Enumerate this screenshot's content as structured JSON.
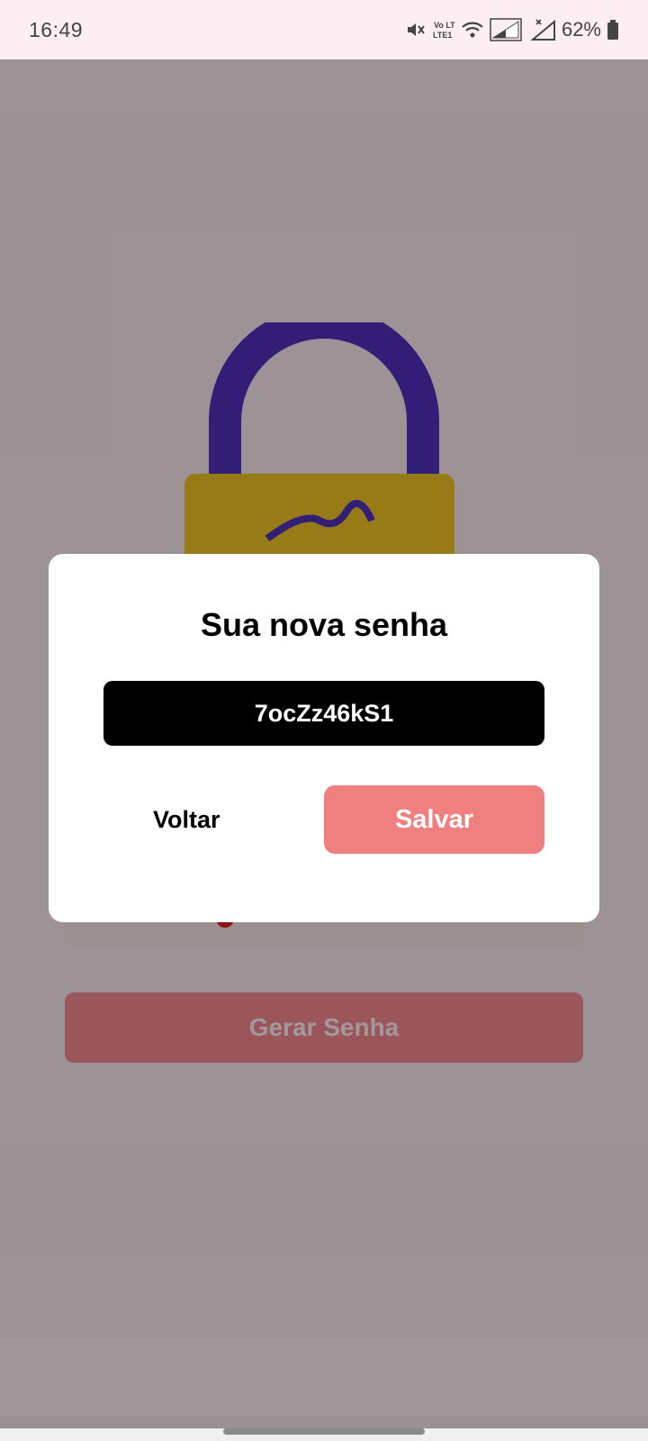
{
  "status_bar": {
    "time": "16:49",
    "battery_percent": "62%",
    "icons": [
      "mute-icon",
      "volte-icon",
      "wifi-icon",
      "signal-icon",
      "signal-no-service-icon",
      "battery-icon"
    ],
    "volte_label": "Vo LTE1"
  },
  "background": {
    "generate_label": "Gerar Senha",
    "accent_color": "#f08080",
    "lock_shackle_color": "#2a15b8",
    "lock_body_color": "#e8c800"
  },
  "dialog": {
    "title": "Sua nova senha",
    "password": "7ocZz46kS1",
    "back_label": "Voltar",
    "save_label": "Salvar"
  }
}
